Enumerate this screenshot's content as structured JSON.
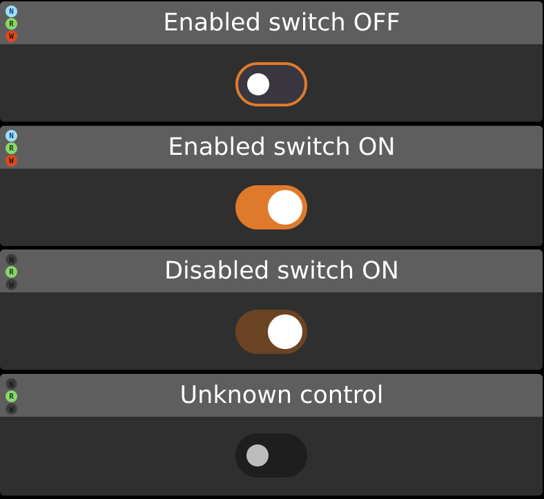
{
  "cards": [
    {
      "title": "Enabled switch OFF",
      "badges": {
        "n": "N",
        "r": "R",
        "w": "W"
      },
      "switch_state": "off",
      "enabled": true
    },
    {
      "title": "Enabled switch ON",
      "badges": {
        "n": "N",
        "r": "R",
        "w": "W"
      },
      "switch_state": "on",
      "enabled": true
    },
    {
      "title": "Disabled switch ON",
      "badges": {
        "n": "N",
        "r": "R",
        "w": "W"
      },
      "switch_state": "on",
      "enabled": false
    },
    {
      "title": "Unknown control",
      "badges": {
        "n": "N",
        "r": "R",
        "w": "W"
      },
      "switch_state": "unknown",
      "enabled": false
    }
  ],
  "colors": {
    "accent": "#df7a2c",
    "disabled_accent": "#6a4323",
    "badge_n": "#9fe0f5",
    "badge_r": "#86d86b",
    "badge_w": "#d84a1e"
  }
}
